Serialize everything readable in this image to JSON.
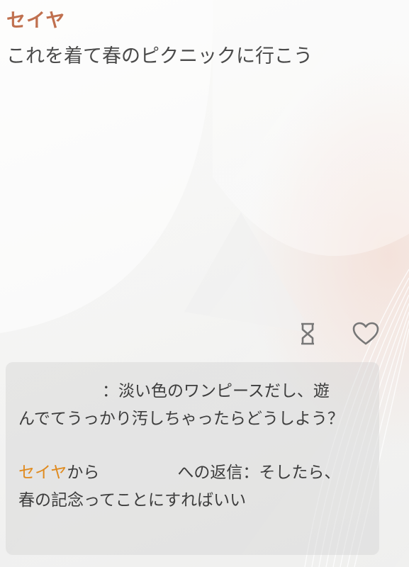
{
  "post": {
    "author": "セイヤ",
    "caption": "これを着て春のピクニックに行こう"
  },
  "actions": {
    "timer_icon": "hourglass-icon",
    "like_icon": "heart-outline-icon"
  },
  "comments": [
    {
      "text": "：淡い色のワンピースだし、遊んでてうっかり汚しちゃったらどうしよう？"
    },
    {
      "reply_author": "セイヤ",
      "reply_from": "から",
      "reply_suffix": "への返信：そしたら、春の記念ってことにすればいい"
    }
  ],
  "colors": {
    "author": "#c0704f",
    "reply_author": "#e08a1e",
    "text": "#4a4a4a",
    "card": "#d2d2d2"
  }
}
